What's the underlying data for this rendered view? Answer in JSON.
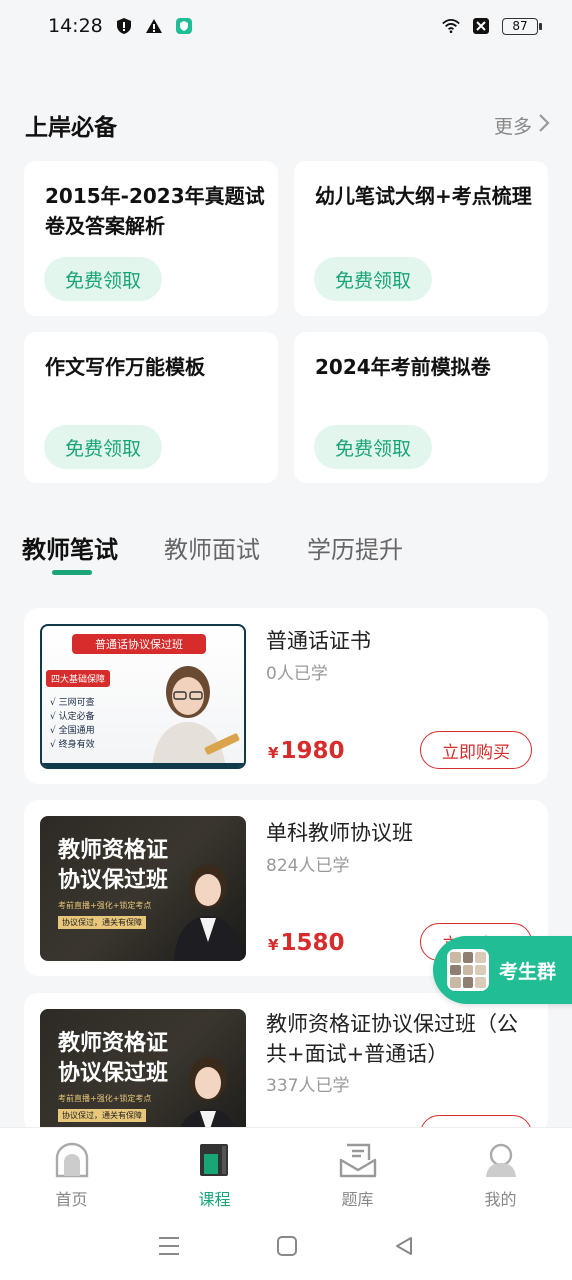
{
  "status_bar": {
    "time": "14:28",
    "battery": "87"
  },
  "section": {
    "title": "上岸必备",
    "more_label": "更多"
  },
  "resources": [
    {
      "title": "2015年-2023年真题试卷及答案解析",
      "button": "免费领取"
    },
    {
      "title": "幼儿笔试大纲+考点梳理",
      "button": "免费领取"
    },
    {
      "title": "作文写作万能模板",
      "button": "免费领取"
    },
    {
      "title": "2024年考前模拟卷",
      "button": "免费领取"
    }
  ],
  "tabs": [
    {
      "label": "教师笔试"
    },
    {
      "label": "教师面试"
    },
    {
      "label": "学历提升"
    }
  ],
  "courses": [
    {
      "name": "普通话证书",
      "count": "0人已学",
      "price_symbol": "¥",
      "price": "1980",
      "button": "立即购买",
      "thumb": {
        "top": "普通话协议保过班",
        "badge": "四大基础保障",
        "bullets": [
          "三网可查",
          "认定必备",
          "全国通用",
          "终身有效"
        ]
      }
    },
    {
      "name": "单科教师协议班",
      "count": "824人已学",
      "price_symbol": "¥",
      "price": "1580",
      "button": "立即购买",
      "thumb": {
        "line1": "教师资格证",
        "line2": "协议保过班",
        "sub": "考前直播+强化+锁定考点",
        "tag": "协议保过，通关有保障"
      }
    },
    {
      "name": "教师资格证协议保过班（公共+面试+普通话）",
      "count": "337人已学",
      "thumb": {
        "line1": "教师资格证",
        "line2": "协议保过班",
        "sub": "考前直播+强化+锁定考点",
        "tag": "协议保过，通关有保障"
      }
    }
  ],
  "group_button": {
    "label": "考生群"
  },
  "bottom_nav": [
    {
      "label": "首页"
    },
    {
      "label": "课程"
    },
    {
      "label": "题库"
    },
    {
      "label": "我的"
    }
  ],
  "colors": {
    "accent": "#1aa579",
    "price": "#d62c2c",
    "group": "#21bd95"
  }
}
